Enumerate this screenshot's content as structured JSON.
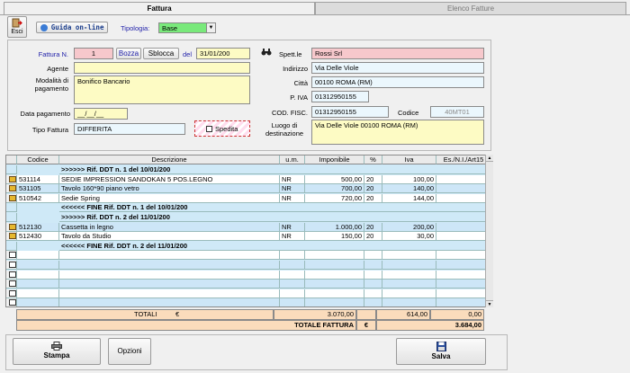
{
  "tabs": [
    {
      "label": "Fattura"
    },
    {
      "label": "Elenco Fatture"
    }
  ],
  "toolbar": {
    "esci_label": "Esci",
    "guida_label": "Guida on-line",
    "tipologia_label": "Tipologia:",
    "tipologia_value": "Base"
  },
  "form": {
    "fattura_label": "Fattura N.",
    "fattura_value": "1",
    "bozza_label": "Bozza",
    "sblocca_label": "Sblocca",
    "del_label": "del",
    "date_value": "31/01/200",
    "agente_label": "Agente",
    "agente_value": "",
    "modalita_label": "Modalità di pagamento",
    "modalita_value": "Bonifico Bancario",
    "data_pagamento_label": "Data pagamento",
    "data_pagamento_value": "__/__/__",
    "tipo_fattura_label": "Tipo Fattura",
    "tipo_fattura_value": "DIFFERITA",
    "spedita_label": "Spedita",
    "spett_label": "Spett.le",
    "spett_value": "Rossi Srl",
    "indirizzo_label": "Indirizzo",
    "indirizzo_value": "Via Delle Viole",
    "citta_label": "Città",
    "citta_value": "00100  ROMA  (RM)",
    "piva_label": "P. IVA",
    "piva_value": "01312950155",
    "codfisc_label": "COD. FISC.",
    "codfisc_value": "01312950155",
    "codice_label": "Codice",
    "codice_value": "40MT01",
    "luogo_label": "Luogo di destinazione",
    "luogo_value": "Via Delle Viole 00100  ROMA (RM)"
  },
  "table": {
    "headers": [
      "Codice",
      "Descrizione",
      "u.m.",
      "Imponibile",
      "%",
      "Iva",
      "Es./N.I./Art15"
    ],
    "rows": [
      {
        "kind": "ddt",
        "text": ">>>>>>  Rif. DDT n. 1  del 10/01/200"
      },
      {
        "kind": "item",
        "codice": "531114",
        "descrizione": "SEDIE IMPRESSION SANDOKAN 5 POS.LEGNO",
        "um": "NR",
        "imponibile": "500,00",
        "perc": "20",
        "iva": "100,00",
        "es": ""
      },
      {
        "kind": "item",
        "codice": "531105",
        "descrizione": "Tavolo 160*90 piano vetro",
        "um": "NR",
        "imponibile": "700,00",
        "perc": "20",
        "iva": "140,00",
        "es": ""
      },
      {
        "kind": "item",
        "codice": "510542",
        "descrizione": "Sedie Spring",
        "um": "NR",
        "imponibile": "720,00",
        "perc": "20",
        "iva": "144,00",
        "es": ""
      },
      {
        "kind": "ddt",
        "text": "<<<<<<  FINE Rif. DDT n. 1  del 10/01/200"
      },
      {
        "kind": "ddt",
        "text": ">>>>>>  Rif. DDT n. 2  del 11/01/200"
      },
      {
        "kind": "item",
        "codice": "512130",
        "descrizione": "Cassetta in legno",
        "um": "NR",
        "imponibile": "1.000,00",
        "perc": "20",
        "iva": "200,00",
        "es": ""
      },
      {
        "kind": "item",
        "codice": "512430",
        "descrizione": "Tavolo da Studio",
        "um": "NR",
        "imponibile": "150,00",
        "perc": "20",
        "iva": "30,00",
        "es": ""
      },
      {
        "kind": "ddt",
        "text": "<<<<<<  FINE Rif. DDT n. 2  del 11/01/200"
      }
    ]
  },
  "totals": {
    "totali_label": "TOTALI",
    "currency": "€",
    "imponibile": "3.070,00",
    "iva": "614,00",
    "es": "0,00",
    "totale_label": "TOTALE FATTURA",
    "totale_value": "3.684,00"
  },
  "footer": {
    "stampa_label": "Stampa",
    "opzioni_label": "Opzioni",
    "salva_label": "Salva"
  }
}
